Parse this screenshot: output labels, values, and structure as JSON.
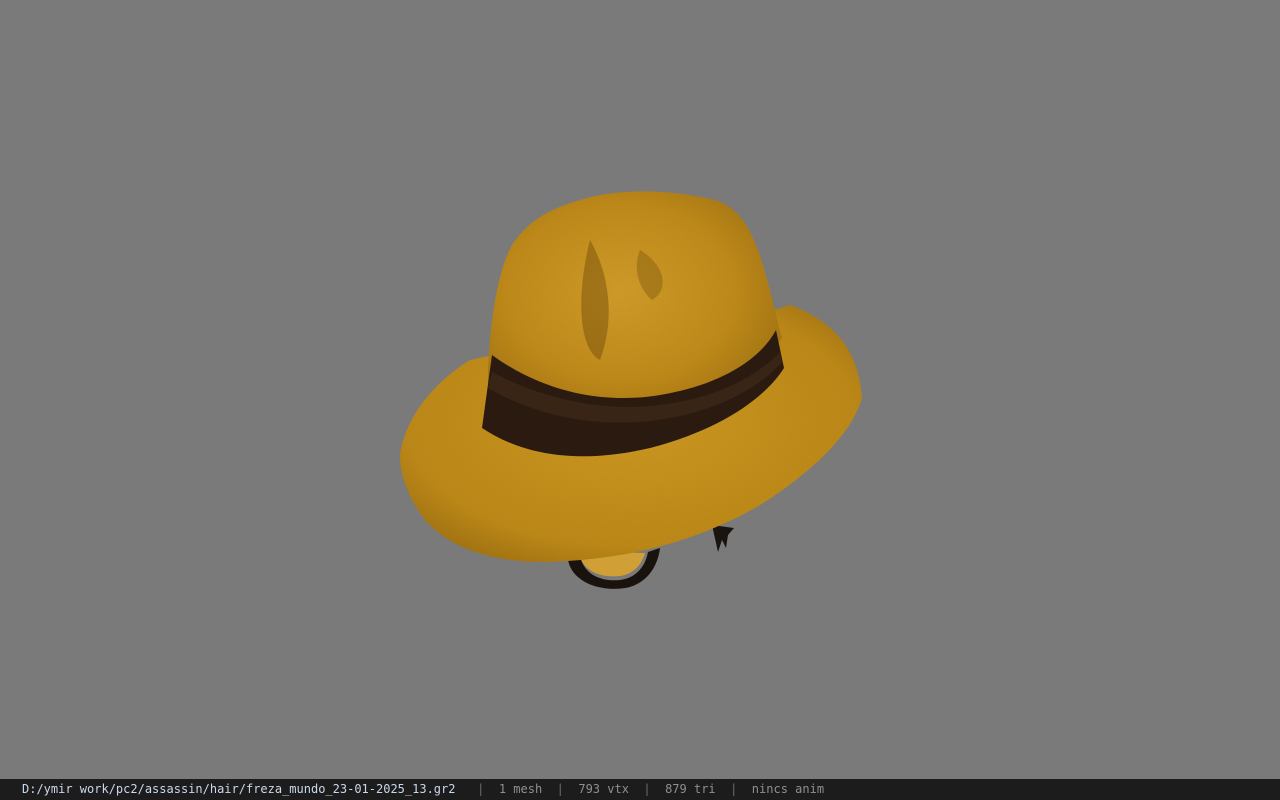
{
  "viewer": {
    "background_color": "#7a7a7a",
    "model": {
      "object": "hat-icon",
      "primary_color": "#d39a1c",
      "band_color": "#2a1a10"
    }
  },
  "statusbar": {
    "file_path": "D:/ymir work/pc2/assassin/hair/freza_mundo_23-01-2025_13.gr2",
    "separator": "|",
    "mesh_count": "1 mesh",
    "vertex_count": "793 vtx",
    "triangle_count": "879 tri",
    "animation": "nincs anim"
  }
}
